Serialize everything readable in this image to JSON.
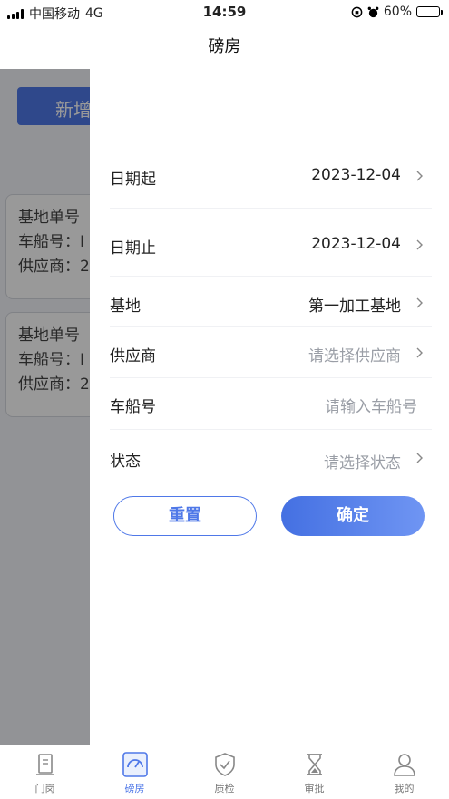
{
  "status_bar": {
    "carrier": "中国移动",
    "network": "4G",
    "time": "14:59",
    "battery": "60%",
    "battery_level": 0.6
  },
  "nav": {
    "title": "磅房"
  },
  "background": {
    "add_button": "新增",
    "cards": [
      {
        "line1": "基地单号",
        "line2": "车船号：I",
        "line3": "供应商：2"
      },
      {
        "line1": "基地单号",
        "line2": "车船号：I",
        "line3": "供应商：2"
      }
    ]
  },
  "filter": {
    "rows": [
      {
        "label": "日期起",
        "value": "2023-12-04"
      },
      {
        "label": "日期止",
        "value": "2023-12-04"
      },
      {
        "label": "基地",
        "value": "第一加工基地"
      },
      {
        "label": "供应商",
        "placeholder": "请选择供应商"
      },
      {
        "label": "车船号",
        "placeholder": "请输入车船号"
      },
      {
        "label": "状态",
        "placeholder": "请选择状态"
      }
    ],
    "reset_label": "重置",
    "confirm_label": "确定"
  },
  "tabbar": {
    "items": [
      {
        "label": "门岗",
        "icon": "gate-icon"
      },
      {
        "label": "磅房",
        "icon": "scale-gauge-icon",
        "active": true
      },
      {
        "label": "质检",
        "icon": "shield-check-icon"
      },
      {
        "label": "审批",
        "icon": "hourglass-icon"
      },
      {
        "label": "我的",
        "icon": "person-icon"
      }
    ]
  },
  "colors": {
    "accent": "#4f78e8",
    "muted_text": "#9a9ea6",
    "overlay": "rgba(0,0,0,0.40)"
  }
}
